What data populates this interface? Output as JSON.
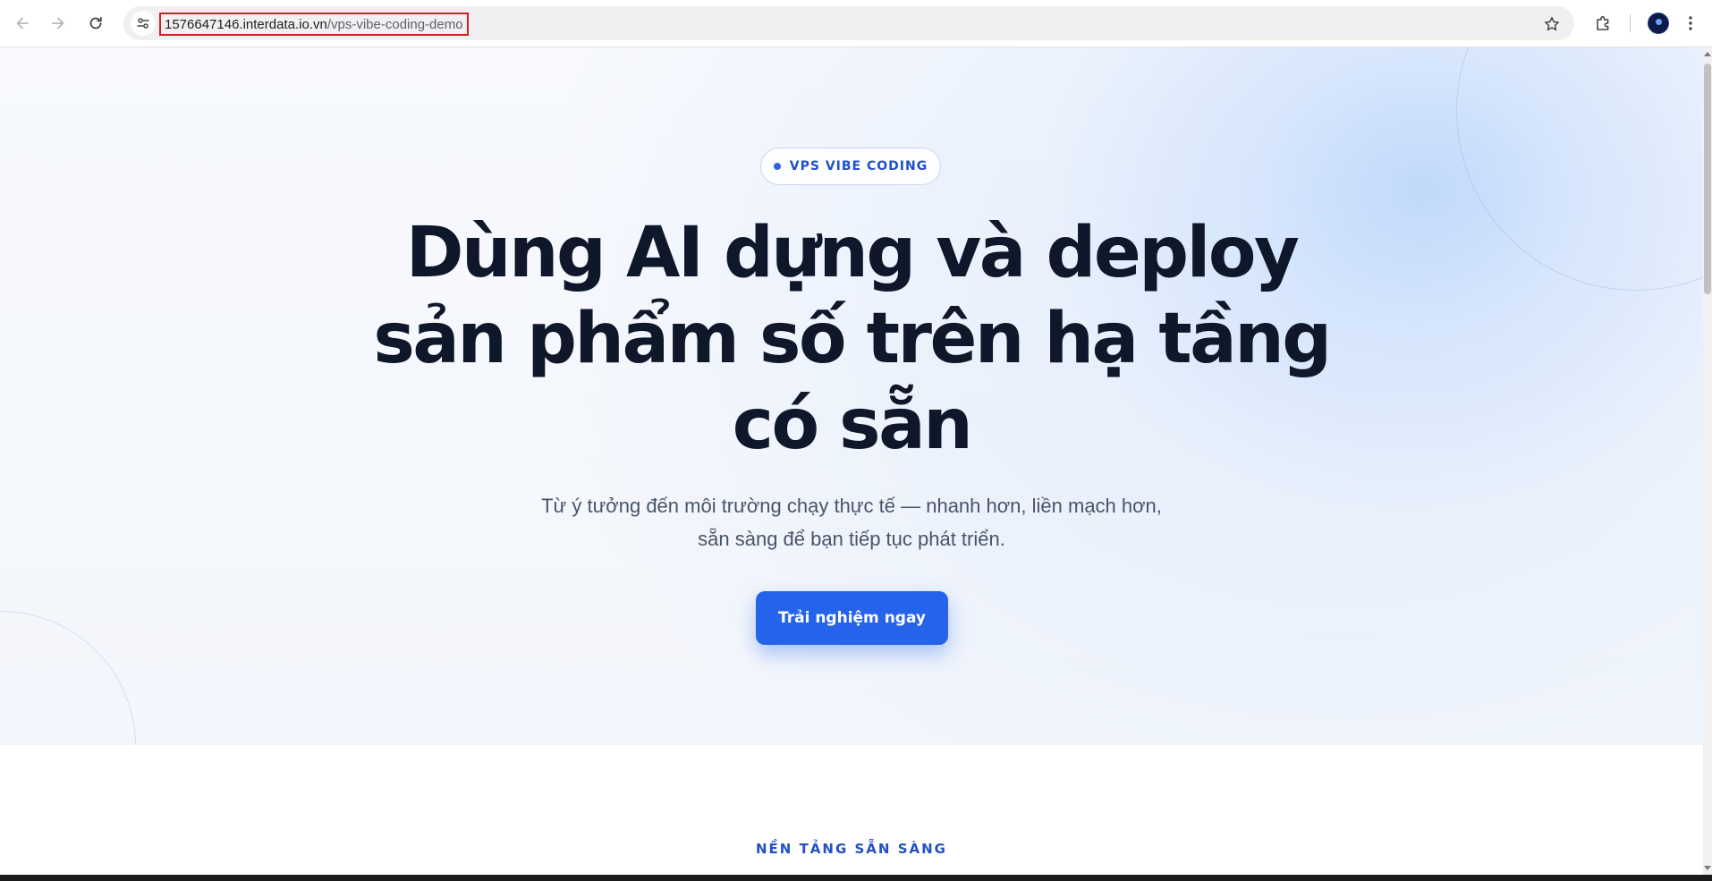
{
  "browser": {
    "url_host": "1576647146.interdata.io.vn",
    "url_path": "/vps-vibe-coding-demo",
    "icons": {
      "back": "arrow-left-icon",
      "forward": "arrow-right-icon",
      "reload": "reload-icon",
      "site_info": "tune-icon",
      "bookmark": "star-icon",
      "extensions": "puzzle-icon",
      "profile": "avatar",
      "menu": "kebab-menu-icon"
    }
  },
  "hero": {
    "badge": "VPS VIBE CODING",
    "title_lines": [
      "Dùng AI dựng và deploy",
      "sản phẩm số trên hạ tầng",
      "có sẵn"
    ],
    "subtitle_lines": [
      "Từ ý tưởng đến môi trường chạy thực tế — nhanh hơn, liền mạch hơn,",
      "sẵn sàng để bạn tiếp tục phát triển."
    ],
    "cta_label": "Trải nghiệm ngay"
  },
  "next_section": {
    "label": "NỀN TẢNG SẴN SÀNG"
  },
  "colors": {
    "accent": "#2563eb",
    "badge_text": "#2150c8",
    "title": "#0f172a",
    "subtitle": "#475569",
    "url_highlight": "#d62020"
  }
}
